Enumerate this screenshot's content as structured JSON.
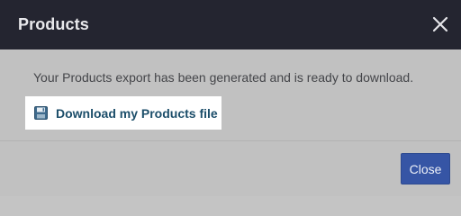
{
  "dialog": {
    "title": "Products",
    "close_icon": "close-icon",
    "message": "Your Products export has been generated and is ready to download.",
    "download_link": {
      "label": "Download my Products file",
      "icon": "save-file-icon"
    },
    "footer": {
      "close_label": "Close"
    }
  },
  "colors": {
    "header_bg": "#242530",
    "overlay_bg": "#c1c1c1",
    "link_text": "#1c4e6a",
    "button_bg": "#3655a5"
  }
}
